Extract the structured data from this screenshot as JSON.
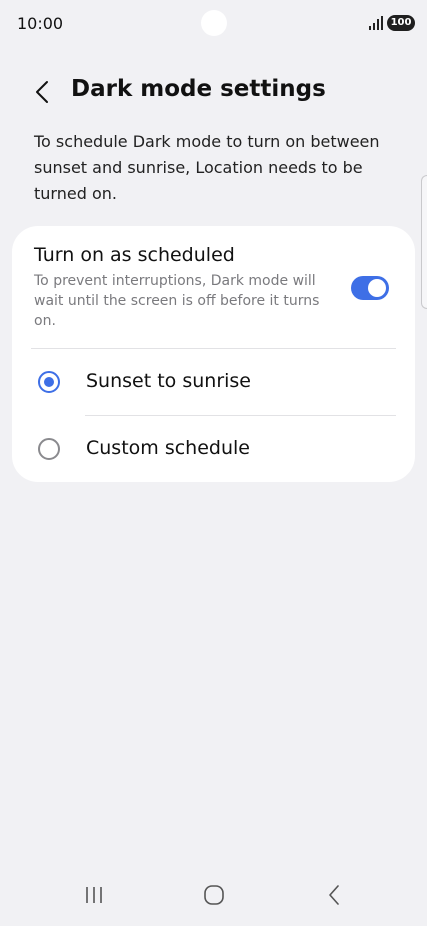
{
  "status_bar": {
    "time": "10:00",
    "battery": "100",
    "icons": [
      "signal-icon",
      "battery-icon"
    ]
  },
  "header": {
    "back_icon": "chevron-left-icon",
    "title": "Dark mode settings"
  },
  "description": "To schedule Dark mode to turn on between sunset and sunrise, Location needs to be turned on.",
  "schedule": {
    "title": "Turn on as scheduled",
    "subtitle": "To prevent interruptions, Dark mode will wait until the screen is off before it turns on.",
    "enabled": true
  },
  "options": [
    {
      "label": "Sunset to sunrise",
      "selected": true
    },
    {
      "label": "Custom schedule",
      "selected": false
    }
  ],
  "nav_bar": {
    "icons": [
      "recents-icon",
      "home-icon",
      "back-icon"
    ]
  },
  "colors": {
    "accent": "#3e6fe6",
    "background": "#f1f1f4",
    "card": "#ffffff"
  }
}
